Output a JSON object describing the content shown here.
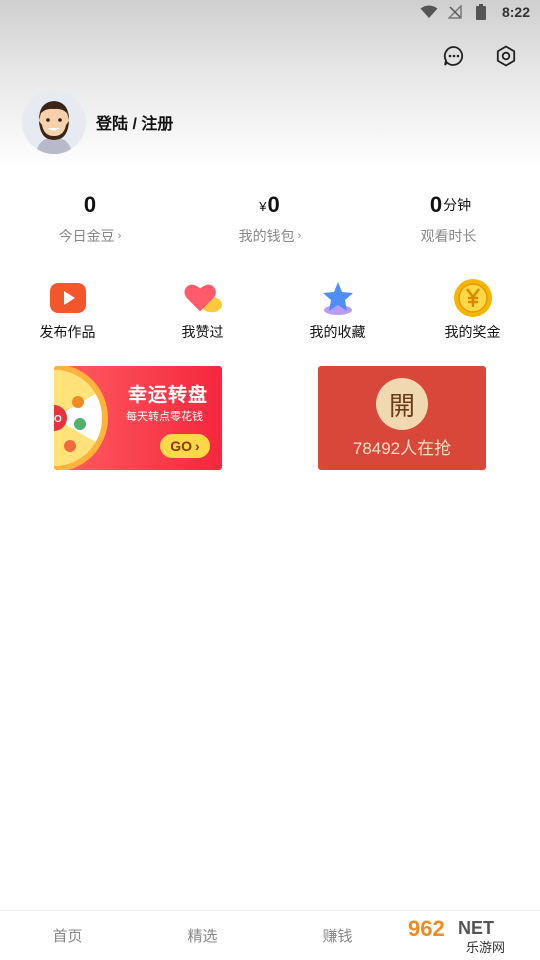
{
  "status_bar": {
    "time": "8:22",
    "icons": [
      "wifi-icon",
      "no-signal-icon",
      "battery-icon"
    ]
  },
  "header": {
    "icons": [
      "message-icon",
      "settings-icon"
    ]
  },
  "profile": {
    "login_label": "登陆 / 注册"
  },
  "stats": [
    {
      "prefix": "",
      "value": "0",
      "suffix": "",
      "label": "今日金豆",
      "chevron": "›"
    },
    {
      "prefix": "¥",
      "value": "0",
      "suffix": "",
      "label": "我的钱包",
      "chevron": "›"
    },
    {
      "prefix": "",
      "value": "0",
      "suffix": "分钟",
      "label": "观看时长",
      "chevron": ""
    }
  ],
  "actions": [
    {
      "label": "发布作品",
      "icon": "publish-play-icon"
    },
    {
      "label": "我赞过",
      "icon": "heart-icon"
    },
    {
      "label": "我的收藏",
      "icon": "star-icon"
    },
    {
      "label": "我的奖金",
      "icon": "gold-coin-icon"
    }
  ],
  "banners": {
    "wheel": {
      "title": "幸运转盘",
      "subtitle": "每天转点零花钱",
      "go_label": "GO",
      "go_arrow": "›"
    },
    "red_packet": {
      "badge": "開",
      "text": "78492人在抢"
    }
  },
  "tabbar": {
    "tabs": [
      "首页",
      "精选",
      "赚钱",
      ""
    ]
  },
  "watermark": {
    "text": "962NET",
    "sub": "乐游网"
  },
  "colors": {
    "accent_red": "#f5263d",
    "packet_red": "#d9463a",
    "gold": "#ffd84a"
  }
}
